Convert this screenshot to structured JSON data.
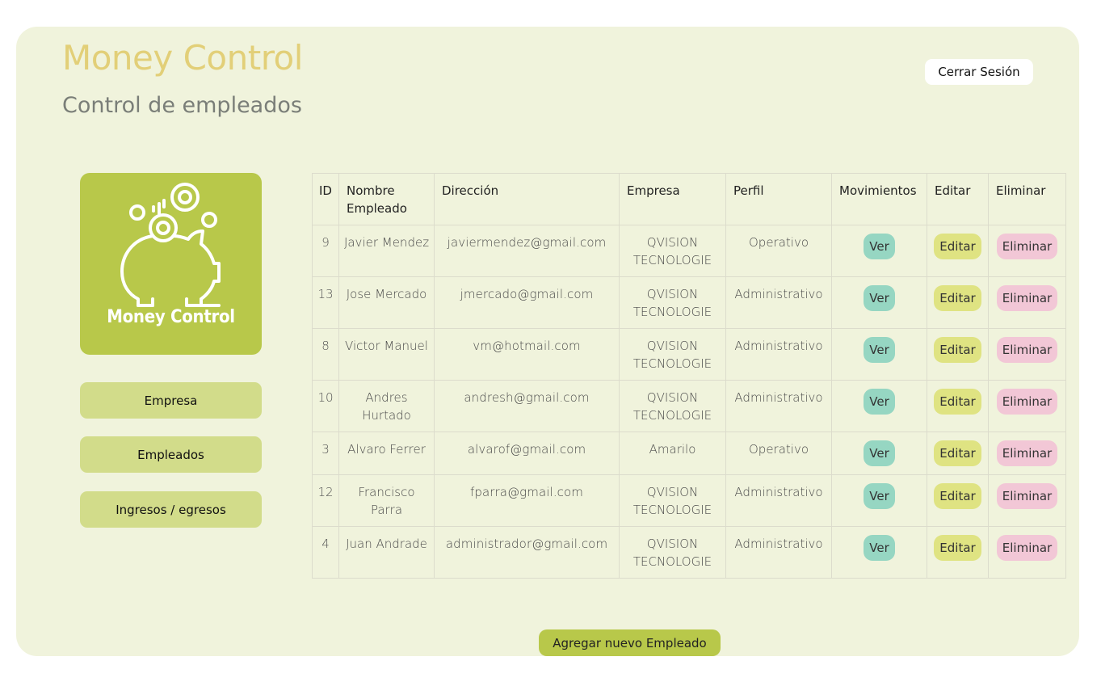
{
  "header": {
    "app_title": "Money Control",
    "subtitle": "Control de empleados",
    "logout_label": "Cerrar Sesión"
  },
  "logo": {
    "text": "Money Control",
    "icon": "piggy-bank-coins-icon",
    "background": "#b8c84a"
  },
  "sidebar": {
    "items": [
      {
        "label": "Empresa"
      },
      {
        "label": "Empleados"
      },
      {
        "label": "Ingresos / egresos"
      }
    ]
  },
  "table": {
    "headers": [
      "ID",
      "Nombre Empleado",
      "Dirección",
      "Empresa",
      "Perfil",
      "Movimientos",
      "Editar",
      "Eliminar"
    ],
    "action_labels": {
      "view": "Ver",
      "edit": "Editar",
      "delete": "Eliminar"
    },
    "rows": [
      {
        "id": "9",
        "name": "Javier Mendez",
        "email": "javiermendez@gmail.com",
        "company": "QVISION TECNOLOGIE",
        "profile": "Operativo"
      },
      {
        "id": "13",
        "name": "Jose Mercado",
        "email": "jmercado@gmail.com",
        "company": "QVISION TECNOLOGIE",
        "profile": "Administrativo"
      },
      {
        "id": "8",
        "name": "Victor Manuel",
        "email": "vm@hotmail.com",
        "company": "QVISION TECNOLOGIE",
        "profile": "Administrativo"
      },
      {
        "id": "10",
        "name": "Andres Hurtado",
        "email": "andresh@gmail.com",
        "company": "QVISION TECNOLOGIE",
        "profile": "Administrativo"
      },
      {
        "id": "3",
        "name": "Alvaro Ferrer",
        "email": "alvarof@gmail.com",
        "company": "Amarilo",
        "profile": "Operativo"
      },
      {
        "id": "12",
        "name": "Francisco Parra",
        "email": "fparra@gmail.com",
        "company": "QVISION TECNOLOGIE",
        "profile": "Administrativo"
      },
      {
        "id": "4",
        "name": "Juan Andrade",
        "email": "administrador@gmail.com",
        "company": "QVISION TECNOLOGIE",
        "profile": "Administrativo"
      }
    ]
  },
  "footer": {
    "add_label": "Agregar nuevo Empleado"
  },
  "colors": {
    "panel": "#f0f3dc",
    "title": "#e2cf78",
    "accent": "#b8c84a",
    "nav": "#d2dc8a",
    "view": "#96d6c2",
    "edit": "#dfe382",
    "delete": "#f2c7d6"
  }
}
